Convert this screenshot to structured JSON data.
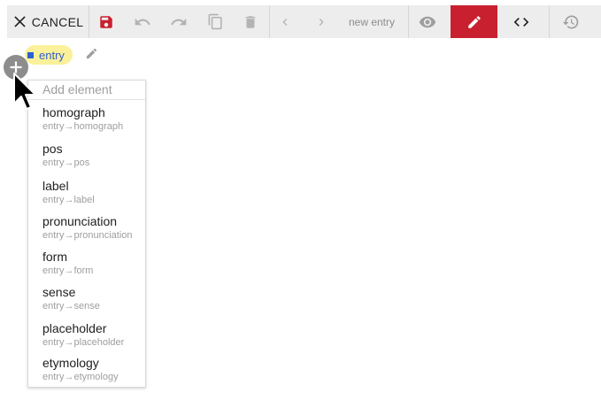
{
  "toolbar": {
    "cancel_label": "CANCEL",
    "new_entry_label": "new entry",
    "active_color": "#c8202f",
    "icons": [
      "close-icon",
      "save-icon",
      "undo-icon",
      "redo-icon",
      "copy-icon",
      "delete-icon",
      "chevron-left-icon",
      "chevron-right-icon",
      "eye-icon",
      "pencil-icon",
      "code-icon",
      "history-icon"
    ]
  },
  "document": {
    "root_element_label": "entry"
  },
  "add_menu": {
    "header": "Add element",
    "items": [
      {
        "label": "homograph",
        "path": "entry→homograph"
      },
      {
        "label": "pos",
        "path": "entry→pos"
      },
      {
        "label": "label",
        "path": "entry→label"
      },
      {
        "label": "pronunciation",
        "path": "entry→pronunciation"
      },
      {
        "label": "form",
        "path": "entry→form"
      },
      {
        "label": "sense",
        "path": "entry→sense"
      },
      {
        "label": "placeholder",
        "path": "entry→placeholder"
      },
      {
        "label": "etymology",
        "path": "entry→etymology"
      }
    ]
  }
}
